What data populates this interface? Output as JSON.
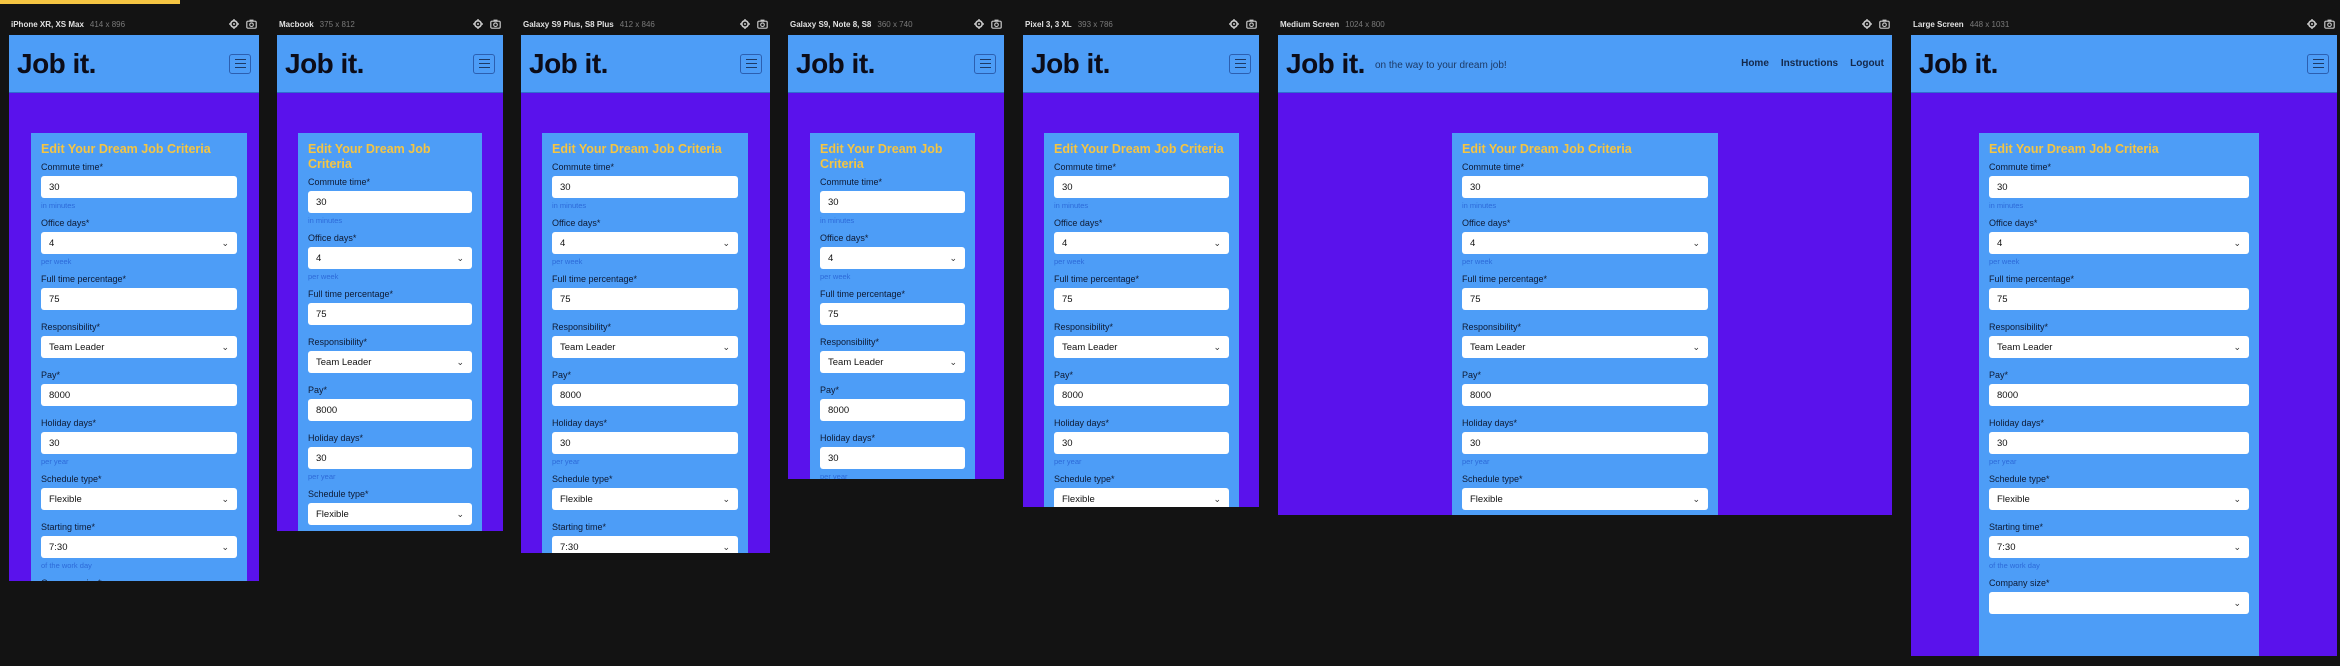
{
  "brand": "Job it.",
  "tagline": "on the way to your dream job!",
  "nav": [
    "Home",
    "Instructions",
    "Logout"
  ],
  "form": {
    "title": "Edit Your Dream Job Criteria",
    "fields": [
      {
        "label": "Commute time*",
        "value": "30",
        "hint": "in minutes",
        "type": "input"
      },
      {
        "label": "Office days*",
        "value": "4",
        "hint": "per week",
        "type": "select"
      },
      {
        "label": "Full time percentage*",
        "value": "75",
        "hint": "",
        "type": "input"
      },
      {
        "label": "Responsibility*",
        "value": "Team Leader",
        "hint": "",
        "type": "select"
      },
      {
        "label": "Pay*",
        "value": "8000",
        "hint": "",
        "type": "input"
      },
      {
        "label": "Holiday days*",
        "value": "30",
        "hint": "per year",
        "type": "input"
      },
      {
        "label": "Schedule type*",
        "value": "Flexible",
        "hint": "",
        "type": "select"
      },
      {
        "label": "Starting time*",
        "value": "7:30",
        "hint": "of the work day",
        "type": "select"
      },
      {
        "label": "Company size*",
        "value": "",
        "hint": "",
        "type": "select"
      }
    ]
  },
  "frames": [
    {
      "name": "iPhone XR, XS Max",
      "size": "414 x 896"
    },
    {
      "name": "Macbook",
      "size": "375 x 812"
    },
    {
      "name": "Galaxy S9 Plus, S8 Plus",
      "size": "412 x 846"
    },
    {
      "name": "Galaxy S9, Note 8, S8",
      "size": "360 x 740"
    },
    {
      "name": "Pixel 3, 3 XL",
      "size": "393 x 786"
    },
    {
      "name": "Medium Screen",
      "size": "1024 x 800"
    },
    {
      "name": "Large Screen",
      "size": "448 x 1031"
    }
  ],
  "icons": {
    "settings": "gear-icon",
    "screenshot": "camera-icon",
    "menu": "hamburger-icon",
    "dropdown": "chevron-down-icon"
  },
  "colors": {
    "header": "#4d9df7",
    "background": "#5a12ec",
    "title": "#f5c542",
    "hint": "#2d6ad8"
  }
}
